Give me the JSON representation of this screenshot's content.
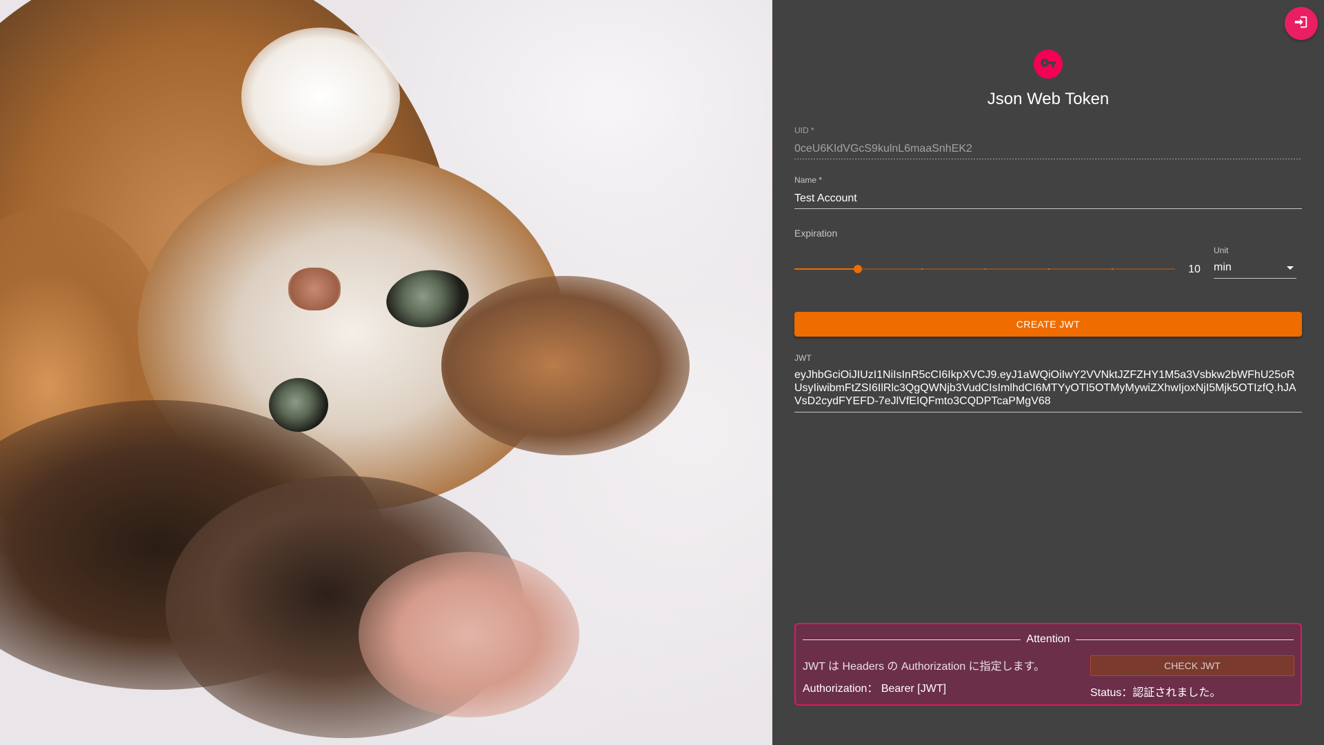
{
  "header": {
    "title": "Json Web Token"
  },
  "form": {
    "uid": {
      "label": "UID *",
      "value": "0ceU6KIdVGcS9kulnL6maaSnhEK2"
    },
    "name": {
      "label": "Name *",
      "value": "Test Account"
    },
    "expiration": {
      "label": "Expiration",
      "value": 10,
      "value_text": "10",
      "min": 0,
      "max": 60,
      "step_marks": [
        10,
        20,
        30,
        40,
        50
      ]
    },
    "unit": {
      "label": "Unit",
      "selected": "min"
    },
    "create_button": "CREATE JWT"
  },
  "jwt": {
    "label": "JWT",
    "value": "eyJhbGciOiJIUzI1NiIsInR5cCI6IkpXVCJ9.eyJ1aWQiOiIwY2VVNktJZFZHY1M5a3Vsbkw2bWFhU25oRUsyIiwibmFtZSI6IlRlc3QgQWNjb3VudCIsImlhdCI6MTYyOTI5OTMyMywiZXhwIjoxNjI5Mjk5OTIzfQ.hJAVsD2cydFYEFD-7eJlVfEIQFmto3CQDPTcaPMgV68"
  },
  "attention": {
    "title": "Attention",
    "note": "JWT は Headers の Authorization に指定します。",
    "authorization": "Authorization： Bearer [JWT]",
    "check_button": "CHECK JWT",
    "status": "Status：認証されました。"
  },
  "icons": {
    "logout": "logout-icon",
    "avatar": "key-icon"
  },
  "colors": {
    "accent_pink": "#e91e63",
    "avatar_pink": "#f50057",
    "primary_orange": "#ef6c00",
    "panel_bg": "#424242",
    "attention_bg": "#6b2f49",
    "attention_border": "#d81b60"
  }
}
